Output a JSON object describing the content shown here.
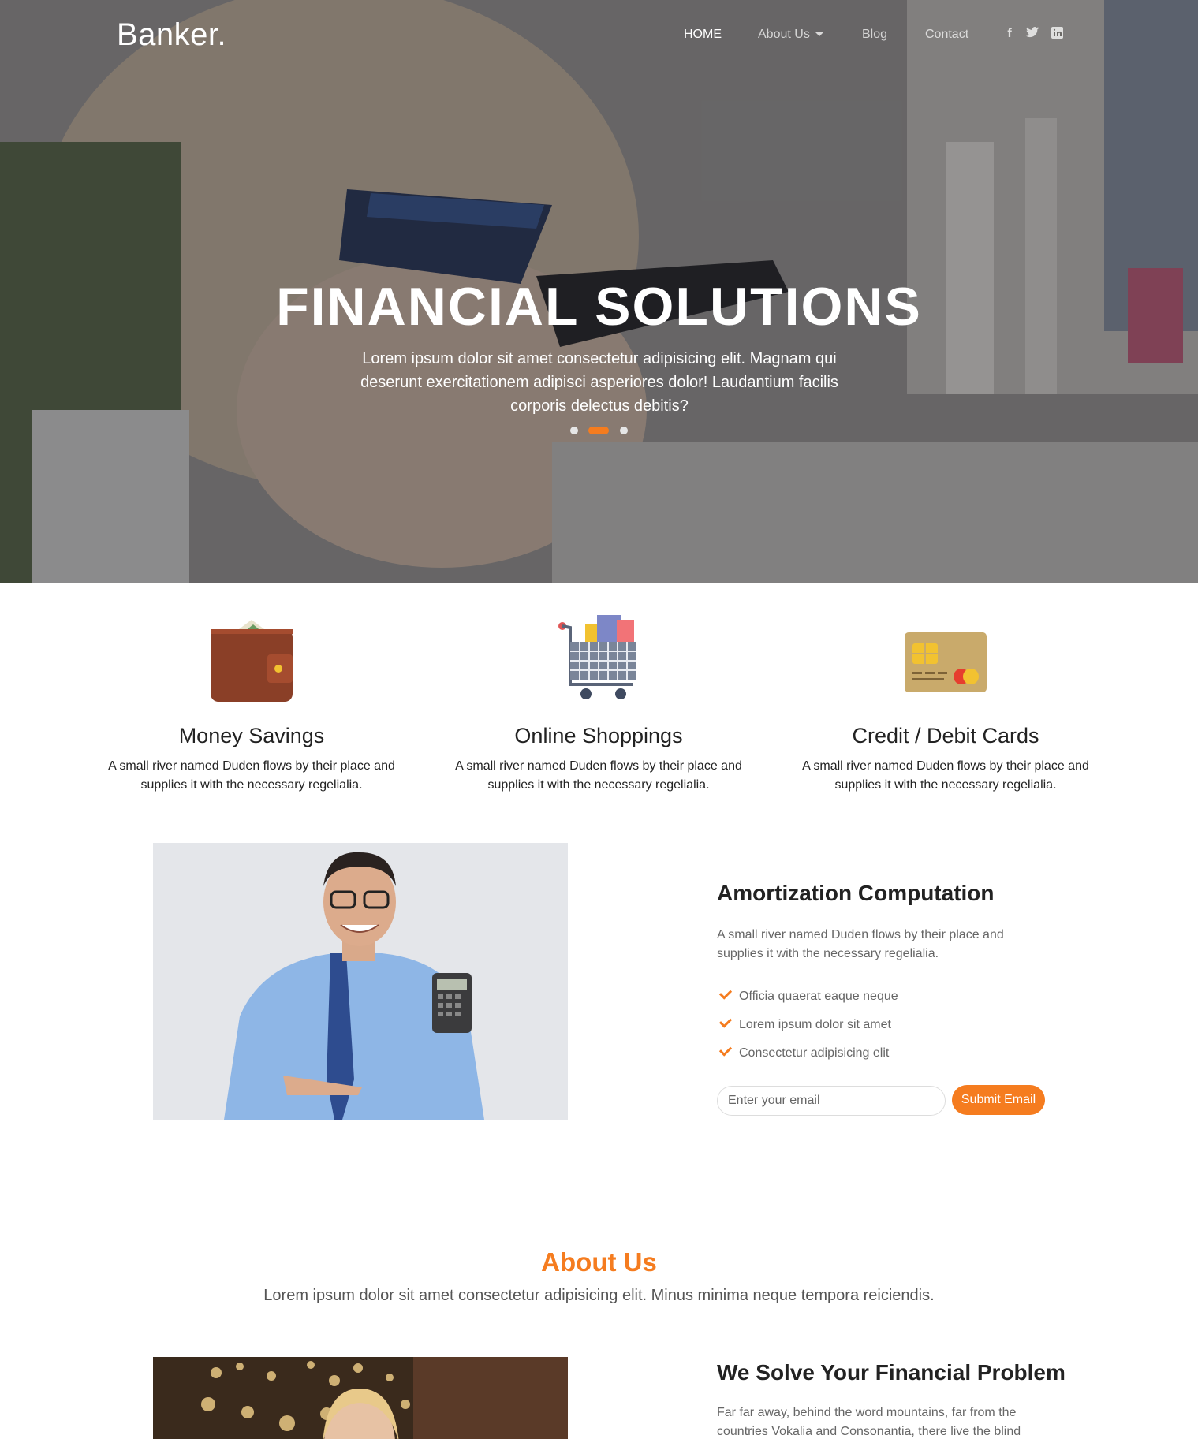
{
  "brand": "Banker.",
  "nav": {
    "home": "HOME",
    "about": "About Us",
    "blog": "Blog",
    "contact": "Contact",
    "social": [
      "facebook-icon",
      "twitter-icon",
      "linkedin-icon"
    ]
  },
  "hero": {
    "title": "FINANCIAL SOLUTIONS",
    "text": "Lorem ipsum dolor sit amet consectetur adipisicing elit. Magnam qui deserunt exercitationem adipisci asperiores dolor! Laudantium facilis corporis delectus debitis?",
    "slides": 3,
    "active_slide": 2
  },
  "services": [
    {
      "icon": "wallet-icon",
      "title": "Money Savings",
      "text": "A small river named Duden flows by their place and supplies it with the necessary regelialia."
    },
    {
      "icon": "shopping-cart-icon",
      "title": "Online Shoppings",
      "text": "A small river named Duden flows by their place and supplies it with the necessary regelialia."
    },
    {
      "icon": "credit-card-icon",
      "title": "Credit / Debit Cards",
      "text": "A small river named Duden flows by their place and supplies it with the necessary regelialia."
    }
  ],
  "amortization": {
    "title": "Amortization Computation",
    "text": "A small river named Duden flows by their place and supplies it with the necessary regelialia.",
    "checklist": [
      "Officia quaerat eaque neque",
      "Lorem ipsum dolor sit amet",
      "Consectetur adipisicing elit"
    ],
    "email_placeholder": "Enter your email",
    "submit_label": "Submit Email"
  },
  "about": {
    "title": "About Us",
    "subtitle": "Lorem ipsum dolor sit amet consectetur adipisicing elit. Minus minima neque tempora reiciendis.",
    "solve_title": "We Solve Your Financial Problem",
    "solve_text": "Far far away, behind the word mountains, far from the countries Vokalia and Consonantia, there live the blind"
  },
  "colors": {
    "accent": "#f57c1f",
    "text_dark": "#222222",
    "text_muted": "#666666"
  }
}
